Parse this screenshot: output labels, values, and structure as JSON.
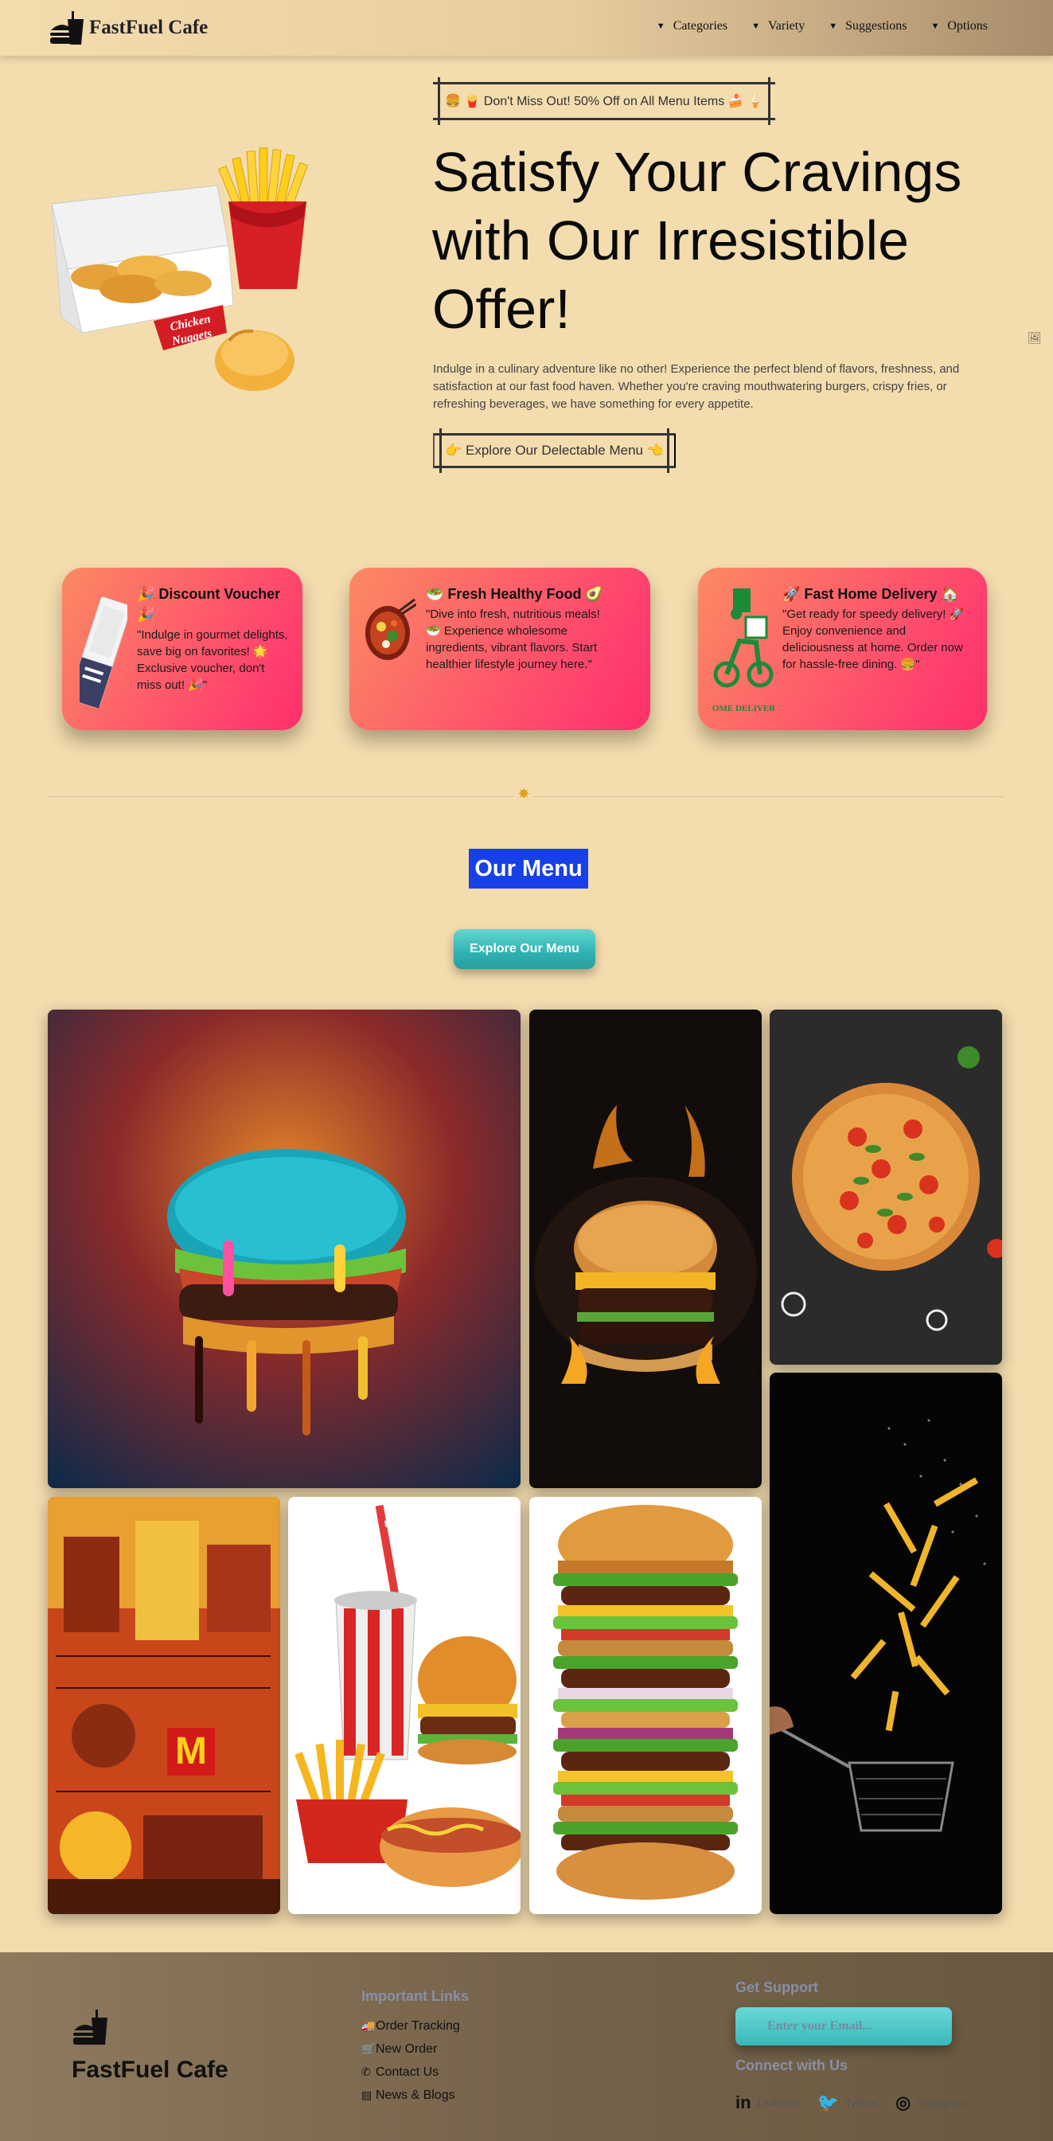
{
  "header": {
    "brand": "FastFuel Cafe",
    "nav": [
      "Categories",
      "Variety",
      "Suggestions",
      "Options"
    ]
  },
  "hero": {
    "badge": "🍔 🍟 Don't Miss Out! 50% Off on All Menu Items 🍰 🍦",
    "title": "Satisfy Your Cravings with Our Irresistible Offer!",
    "description": "Indulge in a culinary adventure like no other! Experience the perfect blend of flavors, freshness, and satisfaction at our fast food haven. Whether you're craving mouthwatering burgers, crispy fries, or refreshing beverages, we have something for every appetite.",
    "button": "👉 Explore Our Delectable Menu 👈",
    "box_label_1": "Chicken",
    "box_label_2": "Nuggets"
  },
  "cards": [
    {
      "title": "🎉 Discount Voucher 🎉",
      "text": "\"Indulge in gourmet delights, save big on favorites! 🌟 Exclusive voucher, don't miss out! 🎉\""
    },
    {
      "title": "🥗 Fresh Healthy Food 🥑",
      "text": "\"Dive into fresh, nutritious meals! 🥗 Experience wholesome ingredients, vibrant flavors. Start healthier lifestyle journey here.\""
    },
    {
      "title": "🚀 Fast Home Delivery 🏠",
      "text": "\"Get ready for speedy delivery! 🚀 Enjoy convenience and deliciousness at home. Order now for hassle-free dining. 🍔\"",
      "image_label": "HOME DELIVERY"
    }
  ],
  "menu": {
    "heading": "Our Menu",
    "button": "Explore Our Menu"
  },
  "gallery_icons": [
    "burger-drip",
    "burger-fire",
    "pizza",
    "fries-basket",
    "fastfood-city",
    "soda-fries-hotdog",
    "tall-burger"
  ],
  "footer": {
    "brand": "FastFuel Cafe",
    "links_heading": "Important Links",
    "links": [
      "Order Tracking",
      "New Order",
      "Contact Us",
      "News & Blogs"
    ],
    "support_heading": "Get Support",
    "email_placeholder": "Enter your Email...",
    "connect_heading": "Connect with Us",
    "socials": [
      "LinkedIn",
      "Twitter",
      "Instagram"
    ]
  }
}
